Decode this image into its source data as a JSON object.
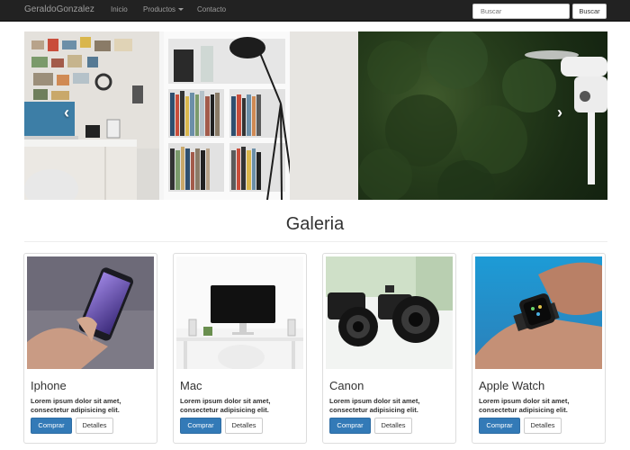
{
  "navbar": {
    "brand": "GeraldoGonzalez",
    "links": [
      "Inicio",
      "Productos",
      "Contacto"
    ],
    "search_placeholder": "Buscar",
    "search_button": "Buscar"
  },
  "carousel": {
    "prev_icon": "chevron-left-icon",
    "next_icon": "chevron-right-icon",
    "slides": 3,
    "active_slide": 3
  },
  "gallery": {
    "title": "Galeria",
    "products": [
      {
        "name": "Iphone",
        "text": "Lorem ipsum dolor sit amet, consectetur adipisicing elit.",
        "buy": "Comprar",
        "details": "Detalles"
      },
      {
        "name": "Mac",
        "text": "Lorem ipsum dolor sit amet, consectetur adipisicing elit.",
        "buy": "Comprar",
        "details": "Detalles"
      },
      {
        "name": "Canon",
        "text": "Lorem ipsum dolor sit amet, consectetur adipisicing elit.",
        "buy": "Comprar",
        "details": "Detalles"
      },
      {
        "name": "Apple Watch",
        "text": "Lorem ipsum dolor sit amet, consectetur adipisicing elit.",
        "buy": "Comprar",
        "details": "Detalles"
      }
    ]
  },
  "colors": {
    "navbar_bg": "#222222",
    "primary_button": "#337ab7"
  }
}
